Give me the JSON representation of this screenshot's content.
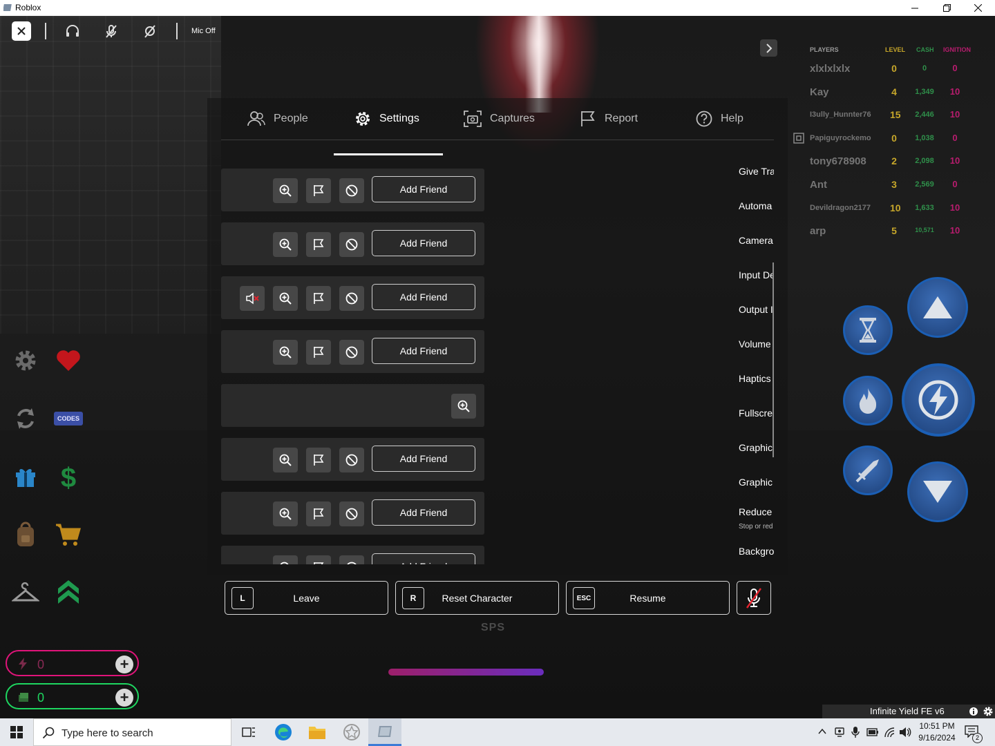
{
  "window": {
    "title": "Roblox"
  },
  "topbar": {
    "mic_status": "Mic Off"
  },
  "leaderboard": {
    "headers": {
      "players": "PLAYERS",
      "level": "LEVEL",
      "cash": "CASH",
      "ignition": "IGNITION"
    },
    "rows": [
      {
        "name": "xlxlxlxlx",
        "level": "0",
        "cash": "0",
        "ignition": "0"
      },
      {
        "name": "Kay",
        "level": "4",
        "cash": "1,349",
        "ignition": "10"
      },
      {
        "name": "I3ully_Hunnter76",
        "level": "15",
        "cash": "2,446",
        "ignition": "10"
      },
      {
        "name": "Papiguyrockemo",
        "level": "0",
        "cash": "1,038",
        "ignition": "0"
      },
      {
        "name": "tony678908",
        "level": "2",
        "cash": "2,098",
        "ignition": "10"
      },
      {
        "name": "Ant",
        "level": "3",
        "cash": "2,569",
        "ignition": "0"
      },
      {
        "name": "Devildragon2177",
        "level": "10",
        "cash": "1,633",
        "ignition": "10"
      },
      {
        "name": "arp",
        "level": "5",
        "cash": "10,571",
        "ignition": "10"
      }
    ]
  },
  "menu": {
    "tabs": [
      {
        "label": "People",
        "icon": "people-icon"
      },
      {
        "label": "Settings",
        "icon": "gear-icon",
        "active": true
      },
      {
        "label": "Captures",
        "icon": "camera-icon"
      },
      {
        "label": "Report",
        "icon": "flag-icon"
      },
      {
        "label": "Help",
        "icon": "help-icon"
      }
    ],
    "people": {
      "add_friend": "Add Friend"
    },
    "settings_items": [
      {
        "label": "Give Tra"
      },
      {
        "label": "Automa"
      },
      {
        "label": "Camera"
      },
      {
        "label": "Input De"
      },
      {
        "label": "Output I"
      },
      {
        "label": "Volume"
      },
      {
        "label": "Haptics"
      },
      {
        "label": "Fullscre"
      },
      {
        "label": "Graphic"
      },
      {
        "label": "Graphic"
      },
      {
        "label": "Reduce",
        "sub": "Stop or red"
      },
      {
        "label": "Backgro"
      }
    ],
    "bottom": {
      "leave": {
        "key": "L",
        "label": "Leave"
      },
      "reset": {
        "key": "R",
        "label": "Reset Character"
      },
      "resume": {
        "key": "ESC",
        "label": "Resume"
      }
    }
  },
  "hud": {
    "sps": "SPS",
    "ignition_count": "0",
    "cash_count": "0",
    "codes_label": "CODES",
    "progress_fraction": 1.0,
    "colors": {
      "ignition": "#e0147a",
      "cash": "#1ed760"
    }
  },
  "infinite_yield": {
    "title": "Infinite Yield FE v6"
  },
  "taskbar": {
    "search_placeholder": "Type here to search",
    "time": "10:51 PM",
    "date": "9/16/2024",
    "notifications": "2"
  }
}
